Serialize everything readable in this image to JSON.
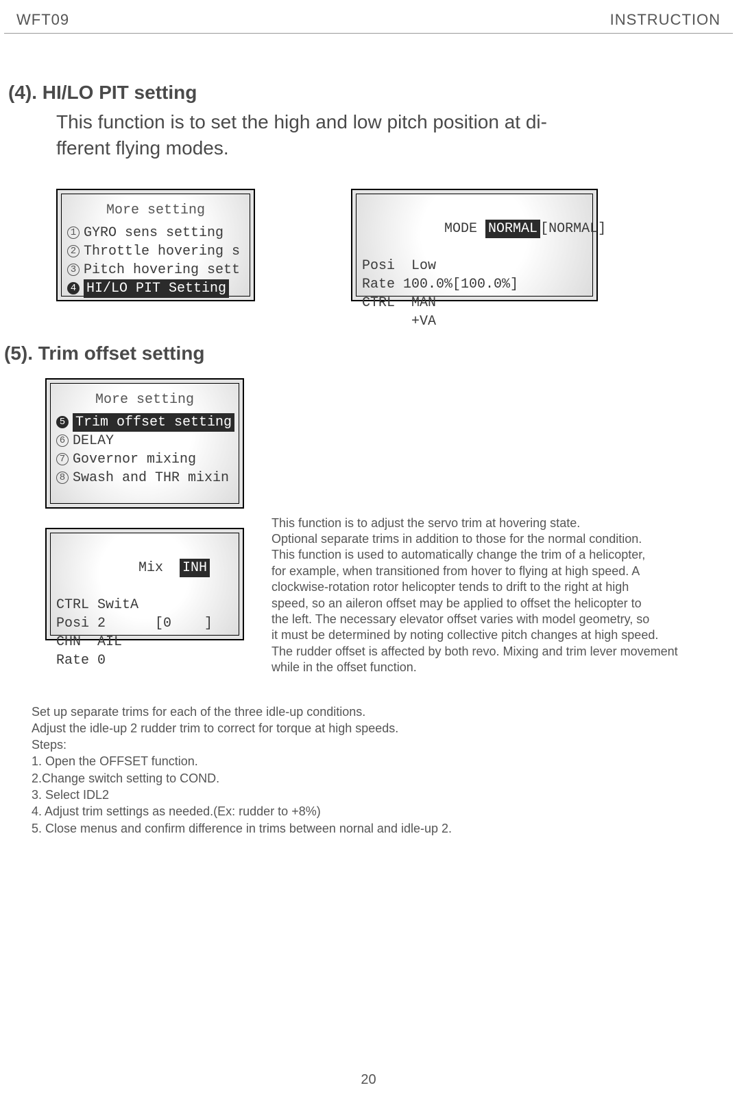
{
  "header": {
    "left": "WFT09",
    "right": "INSTRUCTION"
  },
  "section4": {
    "title": "(4). HI/LO PIT setting",
    "intro_l1": "This function is to set the high and low pitch position  at di-",
    "intro_l2": "fferent flying modes."
  },
  "lcdA": {
    "title": "More setting",
    "items": [
      {
        "n": "1",
        "label": "GYRO sens setting",
        "sel": false
      },
      {
        "n": "2",
        "label": "Throttle hovering s",
        "sel": false
      },
      {
        "n": "3",
        "label": "Pitch hovering sett",
        "sel": false
      },
      {
        "n": "4",
        "label": "HI/LO PIT Setting",
        "sel": true
      }
    ]
  },
  "lcdB": {
    "l1a": "MODE ",
    "l1b": "NORMAL",
    "l1c": "[NORMAL]",
    "l2": "Posi  Low",
    "l3": "Rate 100.0%[100.0%]",
    "l4": "CTRL  MAN",
    "l5": "      +VA"
  },
  "section5": {
    "title": "(5). Trim offset setting"
  },
  "lcdC": {
    "title": "More setting",
    "items": [
      {
        "n": "5",
        "label": "Trim offset setting",
        "sel": true
      },
      {
        "n": "6",
        "label": "DELAY",
        "sel": false
      },
      {
        "n": "7",
        "label": "Governor mixing",
        "sel": false
      },
      {
        "n": "8",
        "label": "Swash and THR mixin",
        "sel": false
      }
    ]
  },
  "lcdD": {
    "l1a": "Mix  ",
    "l1b": "INH",
    "l2": "CTRL SwitA",
    "l3": "Posi 2      [0    ]",
    "l4": "CHN  AIL",
    "l5": "Rate 0"
  },
  "desc": {
    "l1": "This function is to adjust the servo trim at hovering state.",
    "l2": "Optional separate trims in addition to those for the normal condition.",
    "l3": "This function is used to automatically change the trim of a helicopter,",
    "l4": "for example, when transitioned from hover to flying at high speed. A",
    "l5": "clockwise-rotation rotor helicopter tends to drift to the right at high",
    "l6": "speed, so an aileron offset may be applied to offset the helicopter to",
    "l7": "the left. The necessary elevator offset varies with model geometry, so",
    "l8": "it must be determined by noting collective pitch changes at high speed.",
    "l9": "The rudder offset is affected by both revo. Mixing and trim lever movement",
    "l10": "while in the offset function."
  },
  "steps": {
    "s1": "Set up separate trims for each of the three idle-up conditions.",
    "s2": "Adjust the idle-up 2 rudder trim to correct for torque at high speeds.",
    "s3": "Steps:",
    "s4": "1. Open the OFFSET function.",
    "s5": "2.Change switch setting to COND.",
    "s6": "3. Select IDL2",
    "s7": "4. Adjust trim settings as needed.(Ex: rudder to +8%)",
    "s8": "5. Close menus and confirm difference in trims between nornal and idle-up 2."
  },
  "page_number": "20"
}
